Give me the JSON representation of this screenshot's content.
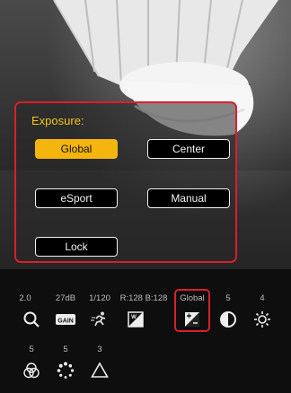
{
  "exposure": {
    "title": "Exposure:",
    "options": [
      "Global",
      "Center",
      "eSport",
      "Manual",
      "Lock"
    ],
    "selected": "Global"
  },
  "toolbar": {
    "row1": [
      {
        "value": "2.0",
        "icon": "zoom-icon"
      },
      {
        "value": "27dB",
        "icon": "gain-icon"
      },
      {
        "value": "1/120",
        "icon": "shutter-runner-icon"
      },
      {
        "value": "R:128 B:128",
        "icon": "white-balance-icon"
      },
      {
        "value": "Global",
        "icon": "exposure-icon"
      },
      {
        "value": "5",
        "icon": "contrast-icon"
      },
      {
        "value": "4",
        "icon": "brightness-icon"
      }
    ],
    "row2": [
      {
        "value": "5",
        "icon": "color-saturation-icon"
      },
      {
        "value": "5",
        "icon": "noise-reduction-icon"
      },
      {
        "value": "3",
        "icon": "sharpness-icon"
      }
    ],
    "gain_text": "GAIN",
    "wb_text": "W"
  },
  "colors": {
    "accent": "#f5b50f",
    "highlight": "#d8202a",
    "title": "#f5c317"
  }
}
